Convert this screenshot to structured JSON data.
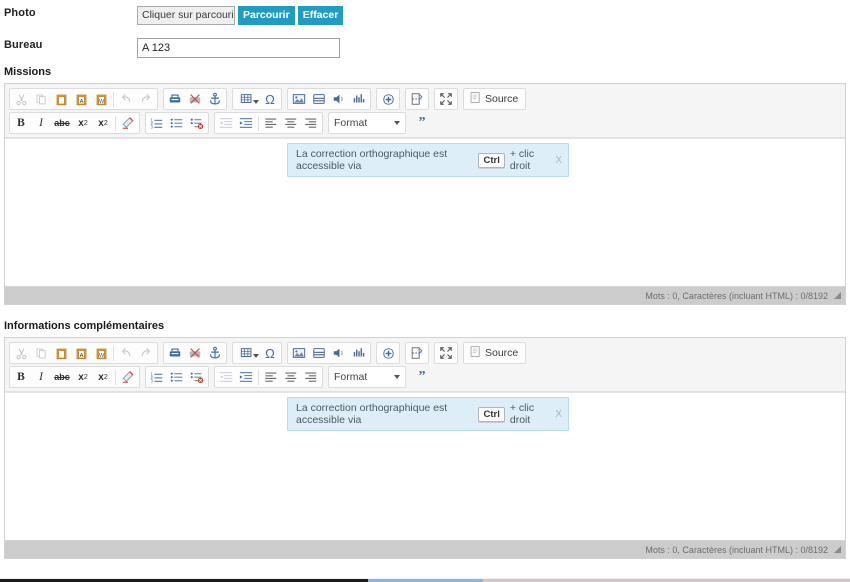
{
  "form": {
    "photo": {
      "label": "Photo",
      "file_input_text": "Cliquer sur parcourir",
      "browse_button": "Parcourir",
      "clear_button": "Effacer"
    },
    "bureau": {
      "label": "Bureau",
      "value": "A 123",
      "placeholder": ""
    }
  },
  "sections": [
    {
      "title": "Missions",
      "notice": {
        "text_before": "La correction orthographique est accessible via",
        "key": "Ctrl",
        "text_after": "+ clic droit",
        "close": "X"
      },
      "status": "Mots : 0, Caractères (incluant HTML) : 0/8192"
    },
    {
      "title": "Informations complémentaires",
      "notice": {
        "text_before": "La correction orthographique est accessible via",
        "key": "Ctrl",
        "text_after": "+ clic droit",
        "close": "X"
      },
      "status": "Mots : 0, Caractères (incluant HTML) : 0/8192"
    }
  ],
  "toolbar": {
    "row1": {
      "clipboard": [
        "cut-icon",
        "copy-icon",
        "paste-icon",
        "paste-text-icon",
        "paste-word-icon",
        "undo-icon",
        "redo-icon"
      ],
      "links": [
        "link-icon",
        "unlink-icon",
        "anchor-icon"
      ],
      "insert1": [
        "table-icon",
        "special-char-icon"
      ],
      "media": [
        "image-icon",
        "flash-icon",
        "audio-icon",
        "sound-icon"
      ],
      "insert2": [
        "insert-plus-icon"
      ],
      "pagebreak": [
        "page-break-icon"
      ],
      "maximize": [
        "maximize-icon"
      ],
      "source_label": "Source"
    },
    "row2": {
      "basic": [
        "bold-icon",
        "italic-icon",
        "strikethrough-icon",
        "subscript-icon",
        "superscript-icon",
        "remove-format-icon"
      ],
      "lists": [
        "numbered-list-icon",
        "bulleted-list-icon",
        "todo-list-icon"
      ],
      "indent": [
        "outdent-icon",
        "indent-icon"
      ],
      "align": [
        "align-left-icon",
        "align-center-icon",
        "align-right-icon"
      ],
      "format_label": "Format",
      "blockquote": "blockquote-icon"
    },
    "bold_label": "B",
    "italic_label": "I",
    "strike_label": "abc",
    "sub_label": "x",
    "sub_sup": "2",
    "sup_label": "x",
    "sup_sup": "2",
    "omega_label": "Ω",
    "quote_label": "”"
  },
  "colors": {
    "accent_teal": "#1f9cc0",
    "notice_bg": "#ddeef8",
    "notice_border": "#b7dcef",
    "toolbar_bg": "#f5f5f5",
    "statusbar_bg": "#cccccc",
    "icon_blue": "#4a6a96"
  }
}
